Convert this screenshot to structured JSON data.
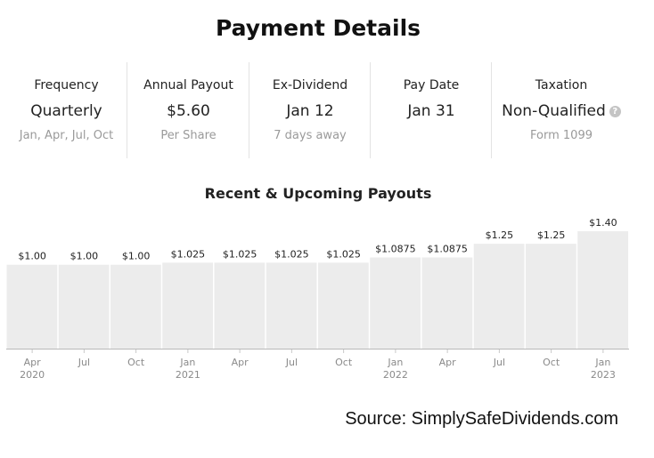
{
  "header": {
    "title": "Payment Details"
  },
  "stats": [
    {
      "label": "Frequency",
      "value": "Quarterly",
      "sub": "Jan, Apr, Jul, Oct"
    },
    {
      "label": "Annual Payout",
      "value": "$5.60",
      "sub": "Per Share"
    },
    {
      "label": "Ex-Dividend",
      "value": "Jan 12",
      "sub": "7 days away"
    },
    {
      "label": "Pay Date",
      "value": "Jan 31",
      "sub": ""
    },
    {
      "label": "Taxation",
      "value": "Non-Qualified",
      "sub": "Form 1099",
      "icon": "question-circle-icon"
    }
  ],
  "chart_data": {
    "type": "bar",
    "title": "Recent & Upcoming Payouts",
    "categories": [
      "Apr 2020",
      "Jul",
      "Oct",
      "Jan 2021",
      "Apr",
      "Jul",
      "Oct",
      "Jan 2022",
      "Apr",
      "Jul",
      "Oct",
      "Jan 2023"
    ],
    "x_tick_lines": [
      [
        "Apr",
        "2020"
      ],
      [
        "Jul"
      ],
      [
        "Oct"
      ],
      [
        "Jan",
        "2021"
      ],
      [
        "Apr"
      ],
      [
        "Jul"
      ],
      [
        "Oct"
      ],
      [
        "Jan",
        "2022"
      ],
      [
        "Apr"
      ],
      [
        "Jul"
      ],
      [
        "Oct"
      ],
      [
        "Jan",
        "2023"
      ]
    ],
    "values": [
      1.0,
      1.0,
      1.0,
      1.025,
      1.025,
      1.025,
      1.025,
      1.0875,
      1.0875,
      1.25,
      1.25,
      1.4
    ],
    "value_labels": [
      "$1.00",
      "$1.00",
      "$1.00",
      "$1.025",
      "$1.025",
      "$1.025",
      "$1.025",
      "$1.0875",
      "$1.0875",
      "$1.25",
      "$1.25",
      "$1.40"
    ],
    "bar_color": "#ececec",
    "grid": false
  },
  "footer": {
    "source": "Source: SimplySafeDividends.com"
  }
}
